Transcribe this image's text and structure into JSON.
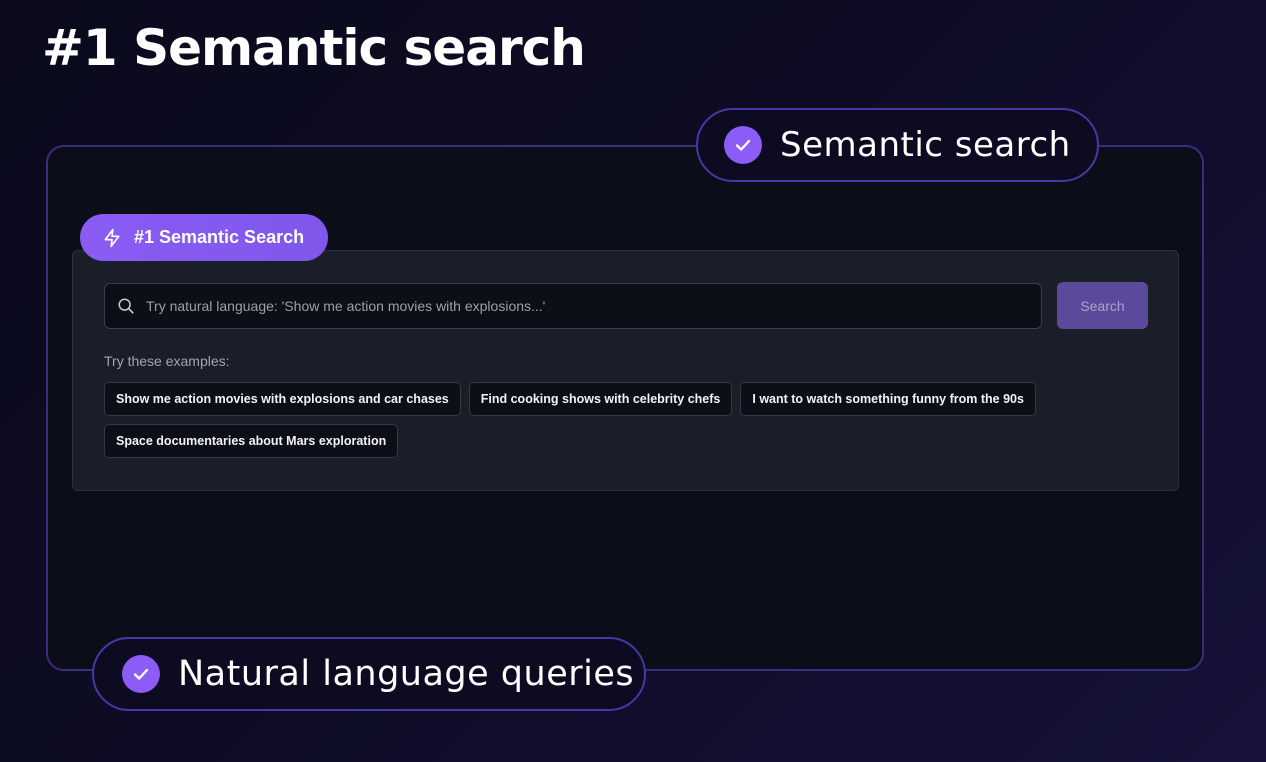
{
  "page": {
    "title": "#1 Semantic search"
  },
  "callouts": {
    "top": {
      "label": "Semantic search",
      "icon": "check-circle-icon"
    },
    "bottom": {
      "label": "Natural language queries",
      "icon": "check-circle-icon"
    }
  },
  "feature_pill": {
    "label": "#1 Semantic Search",
    "icon": "lightning-bolt-icon"
  },
  "search": {
    "placeholder": "Try natural language: 'Show me action movies with explosions...'",
    "value": "",
    "button_label": "Search",
    "icon": "search-icon"
  },
  "examples": {
    "label": "Try these examples:",
    "items": [
      "Show me action movies with explosions and car chases",
      "Find cooking shows with celebrity chefs",
      "I want to watch something funny from the 90s",
      "Space documentaries about Mars exploration"
    ]
  },
  "colors": {
    "accent": "#8b5cf6",
    "button": "#5b4a9c",
    "frame_border": "#3a2d7c",
    "background": "#0a0a1c"
  }
}
